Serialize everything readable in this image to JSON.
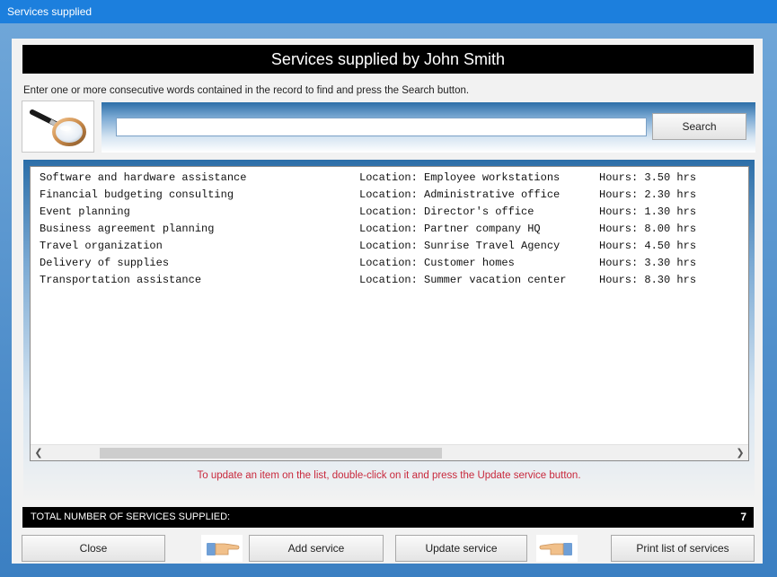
{
  "window": {
    "title": "Services supplied"
  },
  "header": {
    "title": "Services supplied by John Smith"
  },
  "instructions": "Enter one or more consecutive words contained in the record to find and press the Search button.",
  "search": {
    "value": "",
    "button_label": "Search"
  },
  "services": [
    {
      "name": "Software and hardware assistance",
      "location": "Location: Employee workstations",
      "hours": "Hours: 3.50 hrs"
    },
    {
      "name": "Financial budgeting consulting",
      "location": "Location: Administrative office",
      "hours": "Hours: 2.30 hrs"
    },
    {
      "name": "Event planning",
      "location": "Location: Director's office",
      "hours": "Hours: 1.30 hrs"
    },
    {
      "name": "Business agreement planning",
      "location": "Location: Partner company HQ",
      "hours": "Hours: 8.00 hrs"
    },
    {
      "name": "Travel organization",
      "location": "Location: Sunrise Travel Agency",
      "hours": "Hours: 4.50 hrs"
    },
    {
      "name": "Delivery of supplies",
      "location": "Location: Customer homes",
      "hours": "Hours: 3.30 hrs"
    },
    {
      "name": "Transportation assistance",
      "location": "Location: Summer vacation center",
      "hours": "Hours: 8.30 hrs"
    }
  ],
  "hint": "To update an item on the list, double-click on it and press the Update service button.",
  "total": {
    "label": "TOTAL NUMBER OF SERVICES SUPPLIED:",
    "count": "7"
  },
  "buttons": {
    "close": "Close",
    "add": "Add service",
    "update": "Update service",
    "print": "Print list of services"
  },
  "icons": {
    "logo": "magnifying-glass-icon",
    "left_hand": "pointing-hand-icon",
    "right_hand": "pointing-hand-icon"
  },
  "colors": {
    "title_bar": "#1c7fdd",
    "header_bg": "#000000",
    "hint_text": "#c8283c"
  }
}
